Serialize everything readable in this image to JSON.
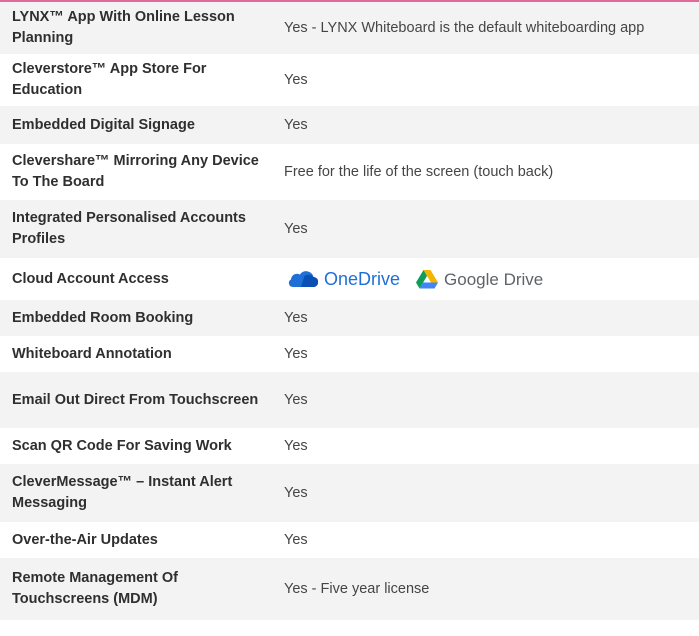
{
  "rows": [
    {
      "feature": "LYNX™ App With Online Lesson Planning",
      "value": "Yes - LYNX Whiteboard is the default whiteboarding app"
    },
    {
      "feature": "Cleverstore™ App Store For Education",
      "value": "Yes"
    },
    {
      "feature": "Embedded Digital Signage",
      "value": "Yes"
    },
    {
      "feature": "Clevershare™ Mirroring Any Device To The Board",
      "value": "Free for the life of the screen (touch back)"
    },
    {
      "feature": "Integrated Personalised Accounts Profiles",
      "value": "Yes"
    },
    {
      "feature": "Cloud Account Access",
      "logos": {
        "onedrive": "OneDrive",
        "google_drive": "Google Drive"
      }
    },
    {
      "feature": "Embedded Room Booking",
      "value": "Yes"
    },
    {
      "feature": "Whiteboard Annotation",
      "value": "Yes"
    },
    {
      "feature": "Email Out Direct From Touchscreen",
      "value": "Yes"
    },
    {
      "feature": "Scan QR Code For Saving Work",
      "value": "Yes"
    },
    {
      "feature": "CleverMessage™ – Instant Alert Messaging",
      "value": "Yes"
    },
    {
      "feature": "Over-the-Air Updates",
      "value": "Yes"
    },
    {
      "feature": "Remote Management Of Touchscreens (MDM)",
      "value": "Yes - Five year license"
    }
  ],
  "colors": {
    "row_shaded": "#f3f3f3",
    "row_plain": "#ffffff",
    "accent": "#e06a9a",
    "onedrive_blue": "#1f6fd6"
  },
  "icons": {
    "onedrive": "onedrive-cloud-icon",
    "google_drive": "google-drive-triangle-icon"
  }
}
